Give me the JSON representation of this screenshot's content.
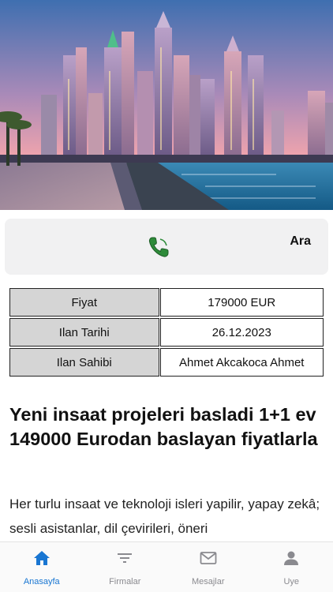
{
  "call": {
    "label": "Ara",
    "icon": "phone-icon"
  },
  "info": [
    {
      "key": "Fiyat",
      "value": "179000 EUR"
    },
    {
      "key": "Ilan Tarihi",
      "value": "26.12.2023"
    },
    {
      "key": "Ilan Sahibi",
      "value": "Ahmet Akcakoca Ahmet"
    }
  ],
  "listing": {
    "title": "Yeni insaat projeleri basladi 1+1 ev 149000 Eurodan baslayan fiyatlarla",
    "description": "Her turlu insaat ve teknoloji isleri yapilir, yapay zekâ; sesli asistanlar, dil çevirileri, öneri"
  },
  "tabs": [
    {
      "label": "Anasayfa",
      "icon": "home-icon",
      "active": true
    },
    {
      "label": "Firmalar",
      "icon": "filter-list-icon",
      "active": false
    },
    {
      "label": "Mesajlar",
      "icon": "mail-icon",
      "active": false
    },
    {
      "label": "Uye",
      "icon": "person-icon",
      "active": false
    }
  ],
  "colors": {
    "accent": "#1976d2",
    "inactive_tab": "#8a8a8f",
    "table_key_bg": "#d5d5d5",
    "call_card_bg": "#f1f1f2",
    "phone_green": "#2e8b3a"
  }
}
